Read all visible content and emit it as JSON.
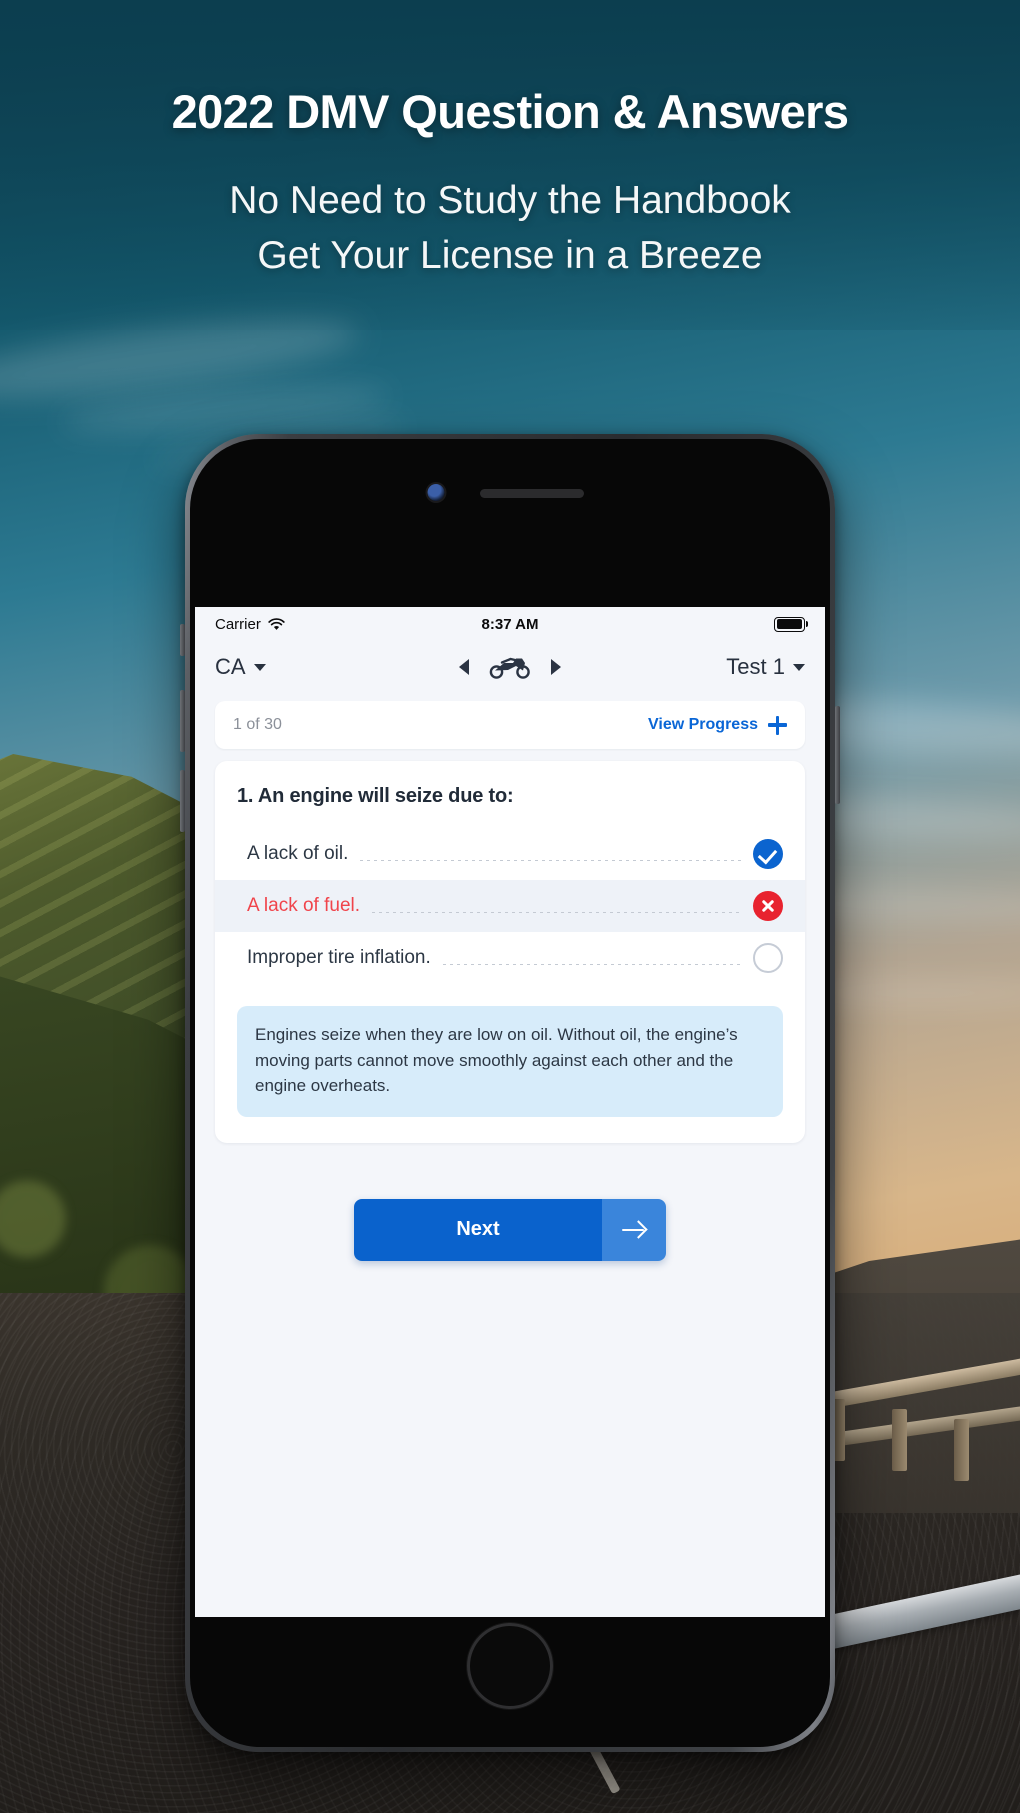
{
  "promo": {
    "headline": "2022 DMV Question & Answers",
    "subline_1": "No Need to Study the Handbook",
    "subline_2": "Get Your License in a Breeze"
  },
  "phone": {
    "status_bar": {
      "carrier": "Carrier",
      "wifi_icon": "wifi-icon",
      "time": "8:37 AM",
      "battery_icon": "battery-full-icon"
    },
    "nav_bar": {
      "state": "CA",
      "state_caret_icon": "chevron-down-icon",
      "prev_icon": "chevron-left-icon",
      "vehicle_icon": "motorcycle-icon",
      "next_icon": "chevron-right-icon",
      "test": "Test 1",
      "test_caret_icon": "chevron-down-icon"
    },
    "progress_bar": {
      "count": "1 of 30",
      "view_progress_label": "View Progress",
      "plus_icon": "plus-icon"
    },
    "question": {
      "title": "1. An engine will seize due to:",
      "answers": [
        {
          "text": "A lack of oil.",
          "state": "correct",
          "mark_icon": "check-circle-icon"
        },
        {
          "text": "A lack of fuel.",
          "state": "wrong-selected",
          "mark_icon": "x-circle-icon"
        },
        {
          "text": "Improper tire inflation.",
          "state": "empty",
          "mark_icon": "empty-circle-icon"
        }
      ],
      "explanation": "Engines seize when they are low on oil. Without oil, the engine’s moving parts cannot move smoothly against each other and the engine overheats."
    },
    "next_button": {
      "label": "Next",
      "arrow_icon": "arrow-right-icon"
    }
  },
  "colors": {
    "accent_blue": "#0a62cc",
    "link_blue": "#0a66d6",
    "correct_blue": "#0b64cf",
    "wrong_red": "#e8232f",
    "wrong_text_red": "#f0444b",
    "explain_bg": "#d7ecfa",
    "screen_bg": "#f4f6fa",
    "bg_teal": "#17404f"
  }
}
